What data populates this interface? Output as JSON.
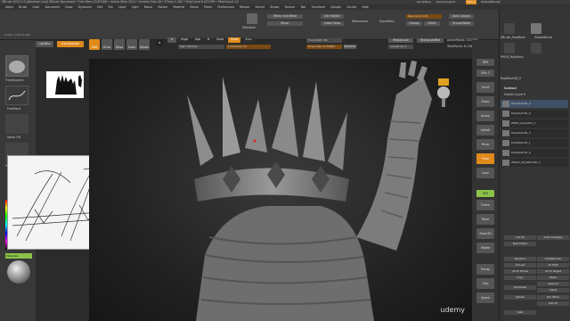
{
  "app": {
    "title_bar": "ZBrush 2022.0.5 [Abraham Leal]   ZBrush Document   • Free Mem 23.674GB • Active Mem 2021 • Scratch Disk 49 • ZTime 1.182 • PolyCount 8.023 MP • MeshCount 24",
    "quicksave": "QuickSave",
    "see_through": "See-through 0",
    "menus_label": "Menus",
    "script": "DefaultZScript"
  },
  "menu": [
    "Alpha",
    "Brush",
    "Color",
    "Document",
    "Draw",
    "Dynamics",
    "Edit",
    "File",
    "Layer",
    "Light",
    "Macro",
    "Marker",
    "Material",
    "Movie",
    "Picker",
    "Preferences",
    "Render",
    "Stencil",
    "Stroke",
    "Texture",
    "Tool",
    "Transform",
    "Zplugin",
    "Zscript",
    "Help"
  ],
  "top_shelf": {
    "coords": "-0.022,-2.271,0.249",
    "lightbox": "LightBox",
    "live_boolean": "Live Boolean",
    "edit": "Edit",
    "draw": "Draw",
    "move": "Move",
    "scale": "Scale",
    "rotate": "Rotate",
    "a": "A",
    "mrgb": "Mrgb",
    "rgb": "Rgb",
    "m": "M",
    "zadd": "Zadd",
    "zsub": "Zsub",
    "zcut": "Zcut",
    "rgb_intensity": "Rgb Intensity",
    "z_intensity": "Z Intensity 43",
    "focal_shift": "Focal Shift -56",
    "draw_size": "Draw Size 11.69984",
    "dynamic": "Dynamic",
    "replay_last": "ReplayLast",
    "replay_last_rel": "ReplayLastRel",
    "adjust_last": "AdjustLast 1",
    "active_points": "ActivePoints: 315,633",
    "total_points": "TotalPoints: 8.128 Mil",
    "zmodeler": "ZModeler",
    "mirror_and_weld": "Mirror And Weld",
    "del_hidden": "Del Hidden",
    "mirror": "Mirror",
    "close_holes": "Close Holes",
    "zremesher": "ZRemesher",
    "dynamesh": "DynaMesh",
    "resolution": "Resolution 128",
    "groups": "Groups",
    "polish": "Polish",
    "auto_groups": "Auto Groups",
    "group_visible": "GroupVisible"
  },
  "left_shelf": {
    "brush1": "TrimDynamic",
    "brush2": "FreeHand",
    "alpha": "Alpha Off",
    "texture": "Texture Off",
    "material": "Materials"
  },
  "right_panel": {
    "subtool_title": "Subtool",
    "visible_count": "Visible Count 9",
    "top_meshes": [
      "ZBrush_PolyMesh",
      "SimpleBrush",
      "PM3D_PolyMesh",
      "PolyMesh3D_5"
    ],
    "subtools": [
      "PolyMesh3D_2",
      "PolyMesh3D_4",
      "PM3D_Cube3D1_1",
      "PolyMesh3D_3",
      "PolyMesh3D_1",
      "PolyMesh3D_6",
      "ZMesh_PolyMesh3D_7"
    ],
    "list_all": "List All",
    "auto_collapse": "Auto Collapse",
    "new_folder": "New Folder",
    "rename": "Rename",
    "auto_reorder": "AutoReorder",
    "all_low": "All Low",
    "all_high": "All High",
    "all_to_home": "All To Home",
    "all_to_target": "All To Target",
    "copy": "Copy",
    "paste": "Paste",
    "duplicate": "Duplicate",
    "append": "Append",
    "insert": "Insert",
    "delete": "Delete",
    "del_other": "Del Other",
    "del_all": "Del All",
    "split": "Split"
  },
  "right_shelf": [
    "BPR",
    "SPix 3",
    "Scroll",
    "Zoom",
    "Actual",
    "AAHalf",
    "Persp",
    "Floor",
    "Local",
    "Frame",
    "Move",
    "Zoom3D",
    "Rotate",
    "Transp",
    "Solo",
    "Xpose"
  ],
  "watermark": "udemy",
  "colors": {
    "orange": "#e08a1c",
    "green": "#8bc34a",
    "canvas_dark": "#1f1f1f",
    "panel": "#353535",
    "model": "#8a8a8a"
  }
}
